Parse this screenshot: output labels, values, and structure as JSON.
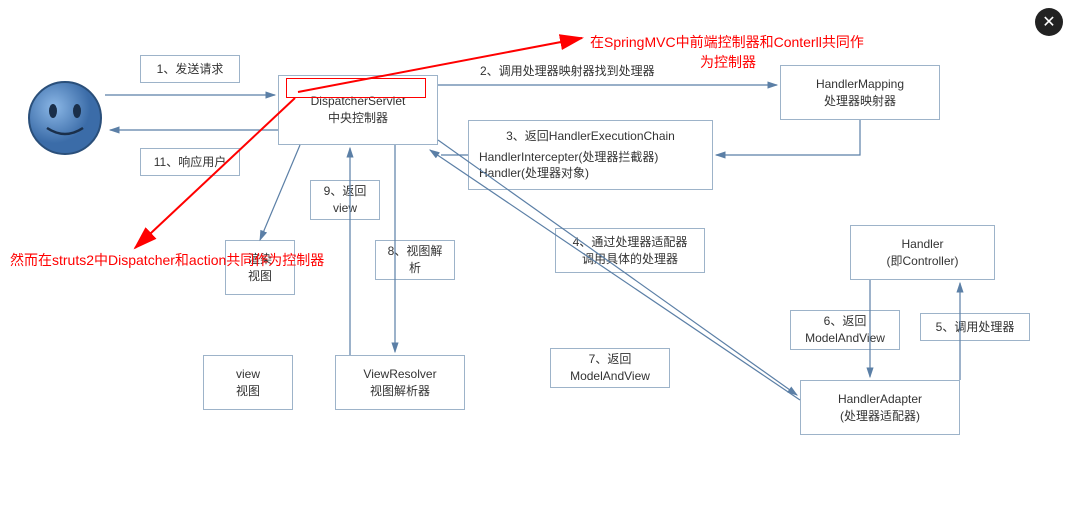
{
  "annotations": {
    "red1_line1": "在SpringMVC中前端控制器和Conterll共同作",
    "red1_line2": "为控制器",
    "red2": "然而在struts2中Dispatcher和action共同作为控制器"
  },
  "nodes": {
    "dispatcher_title": "DispatcherServlet",
    "dispatcher_sub": "中央控制器",
    "handler_mapping_title": "HandlerMapping",
    "handler_mapping_sub": "处理器映射器",
    "chain_title": "3、返回HandlerExecutionChain",
    "chain_line1": "HandlerIntercepter(处理器拦截器)",
    "chain_line2": "Handler(处理器对象)",
    "handler_title": "Handler",
    "handler_sub": "(即Controller)",
    "adapter_title": "HandlerAdapter",
    "adapter_sub": "(处理器适配器)",
    "view_resolver_title": "ViewResolver",
    "view_resolver_sub": "视图解析器",
    "view_title": "view",
    "view_sub": "视图",
    "render_title": "渲染",
    "render_sub": "视图"
  },
  "edges": {
    "e1": "1、发送请求",
    "e2": "2、调用处理器映射器找到处理器",
    "e4_line1": "4、通过处理器适配器",
    "e4_line2": "调用具体的处理器",
    "e5": "5、调用处理器",
    "e6_line1": "6、返回",
    "e6_line2": "ModelAndView",
    "e7_line1": "7、返回",
    "e7_line2": "ModelAndView",
    "e8_line1": "8、视图解",
    "e8_line2": "析",
    "e9_line1": "9、返回",
    "e9_line2": "view",
    "e11": "11、响应用户"
  },
  "ui": {
    "close": "✕"
  }
}
